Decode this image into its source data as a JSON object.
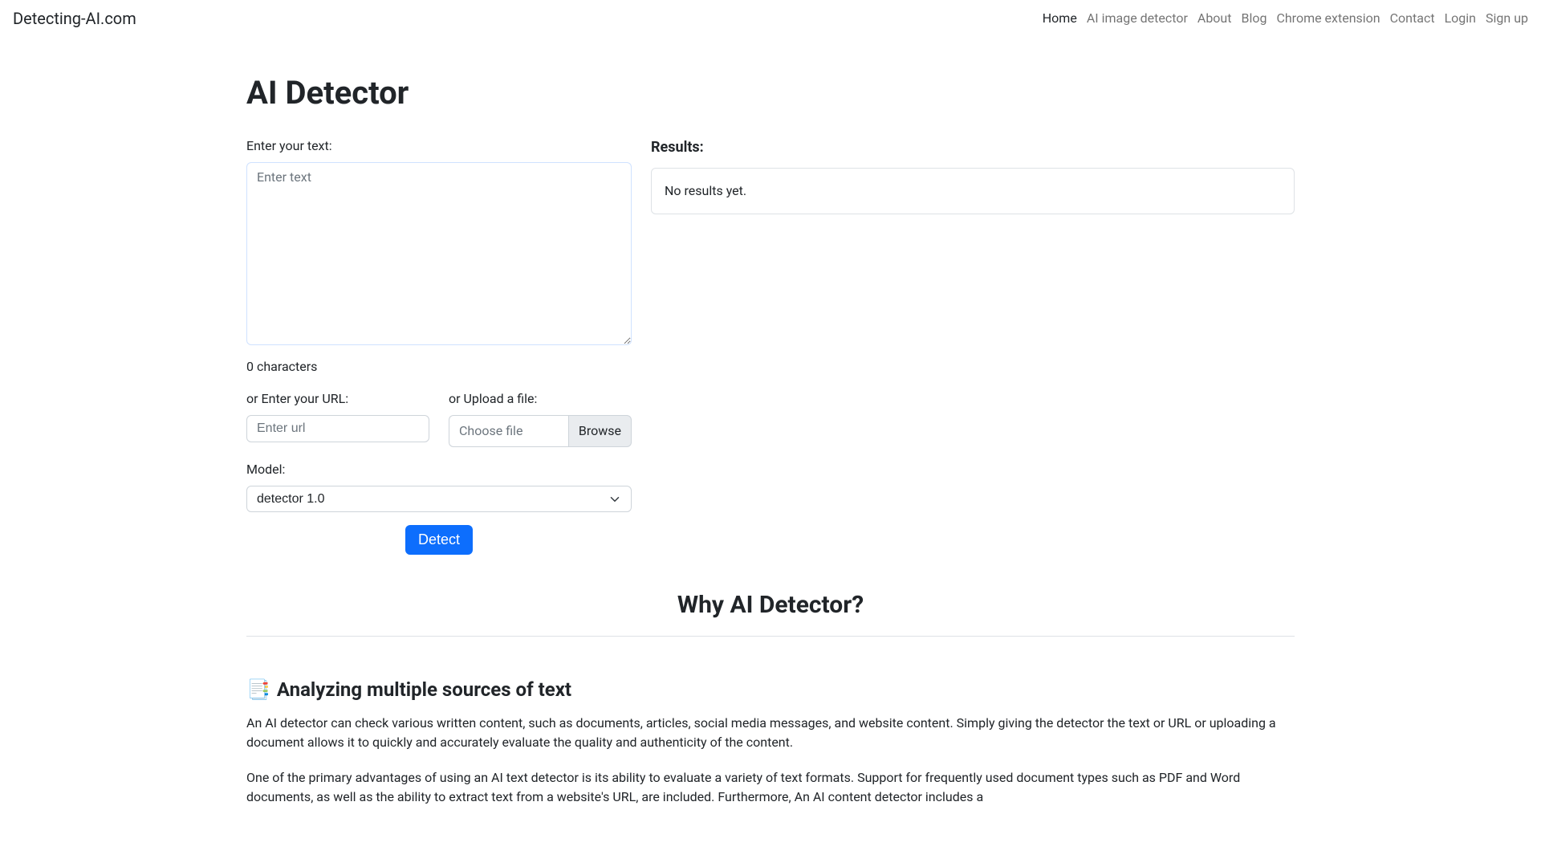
{
  "navbar": {
    "brand": "Detecting-AI.com",
    "links": [
      {
        "label": "Home",
        "active": true
      },
      {
        "label": "AI image detector",
        "active": false
      },
      {
        "label": "About",
        "active": false
      },
      {
        "label": "Blog",
        "active": false
      },
      {
        "label": "Chrome extension",
        "active": false
      },
      {
        "label": "Contact",
        "active": false
      },
      {
        "label": "Login",
        "active": false
      },
      {
        "label": "Sign up",
        "active": false
      }
    ]
  },
  "page": {
    "title": "AI Detector"
  },
  "form": {
    "text_label": "Enter your text:",
    "text_placeholder": "Enter text",
    "char_count": "0 characters",
    "url_label": "or Enter your URL:",
    "url_placeholder": "Enter url",
    "file_label": "or Upload a file:",
    "file_placeholder": "Choose file",
    "file_browse": "Browse",
    "model_label": "Model:",
    "model_selected": "detector 1.0",
    "detect_button": "Detect"
  },
  "results": {
    "title": "Results:",
    "empty": "No results yet."
  },
  "why": {
    "title": "Why AI Detector?"
  },
  "feature1": {
    "icon": "📑",
    "title": "Analyzing multiple sources of text",
    "p1": "An AI detector can check various written content, such as documents, articles, social media messages, and website content. Simply giving the detector the text or URL or uploading a document allows it to quickly and accurately evaluate the quality and authenticity of the content.",
    "p2": "One of the primary advantages of using an AI text detector is its ability to evaluate a variety of text formats. Support for frequently used document types such as PDF and Word documents, as well as the ability to extract text from a website's URL, are included. Furthermore, An AI content detector includes a"
  }
}
